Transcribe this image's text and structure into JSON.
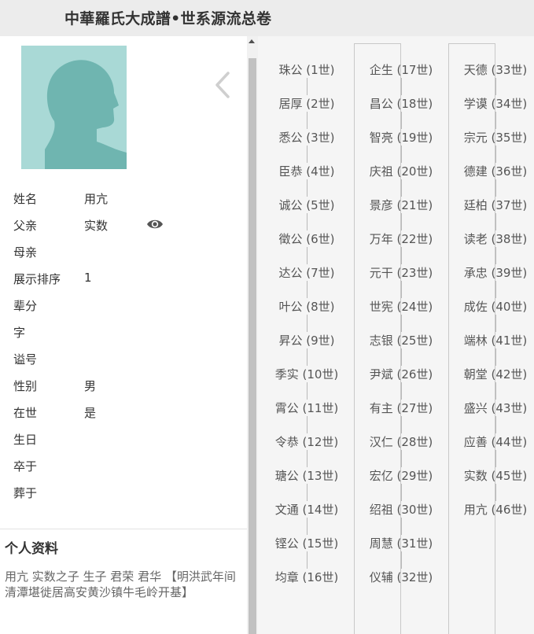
{
  "header": {
    "title": "中華羅氏大成譜•世系源流总卷"
  },
  "person": {
    "avatar_icon": "person-silhouette-icon",
    "fields": [
      {
        "label": "姓名",
        "value": "用亢"
      },
      {
        "label": "父亲",
        "value": "实数"
      },
      {
        "label": "母亲",
        "value": ""
      },
      {
        "label": "展示排序",
        "value": "1"
      },
      {
        "label": "辈分",
        "value": ""
      },
      {
        "label": "字",
        "value": ""
      },
      {
        "label": "谥号",
        "value": ""
      },
      {
        "label": "性别",
        "value": "男"
      },
      {
        "label": "在世",
        "value": "是"
      },
      {
        "label": "生日",
        "value": ""
      },
      {
        "label": "卒于",
        "value": ""
      },
      {
        "label": "葬于",
        "value": ""
      }
    ]
  },
  "profile": {
    "heading": "个人资料",
    "text": "用亢 实数之子  生子  君荣  君华 【明洪武年间清潭堪徙居高安黄沙镇牛毛岭开基】"
  },
  "lineage": {
    "columns": [
      [
        "珠公 (1世)",
        "居厚 (2世)",
        "悉公 (3世)",
        "臣恭 (4世)",
        "诚公 (5世)",
        "徵公 (6世)",
        "达公 (7世)",
        "叶公 (8世)",
        "昇公 (9世)",
        "季实 (10世)",
        "霄公 (11世)",
        "令恭 (12世)",
        "瑭公 (13世)",
        "文通 (14世)",
        "铿公 (15世)",
        "均章 (16世)"
      ],
      [
        "企生 (17世)",
        "昌公 (18世)",
        "智亮 (19世)",
        "庆祖 (20世)",
        "景彦 (21世)",
        "万年 (22世)",
        "元干 (23世)",
        "世宪 (24世)",
        "志银 (25世)",
        "尹斌 (26世)",
        "有主 (27世)",
        "汉仁 (28世)",
        "宏亿 (29世)",
        "绍祖 (30世)",
        "周慧 (31世)",
        "仪辅 (32世)"
      ],
      [
        "天德 (33世)",
        "学谟 (34世)",
        "宗元 (35世)",
        "德建 (36世)",
        "廷柏 (37世)",
        "读老 (38世)",
        "承忠 (39世)",
        "成佐 (40世)",
        "端林 (41世)",
        "朝堂 (42世)",
        "盛兴 (43世)",
        "应善 (44世)",
        "实数 (45世)",
        "用亢 (46世)"
      ]
    ]
  },
  "colors": {
    "header_bg": "#ececec",
    "avatar_bg": "#a9d9d6",
    "avatar_figure": "#6fb5b0",
    "lineage_bg": "#f5f5f5"
  }
}
